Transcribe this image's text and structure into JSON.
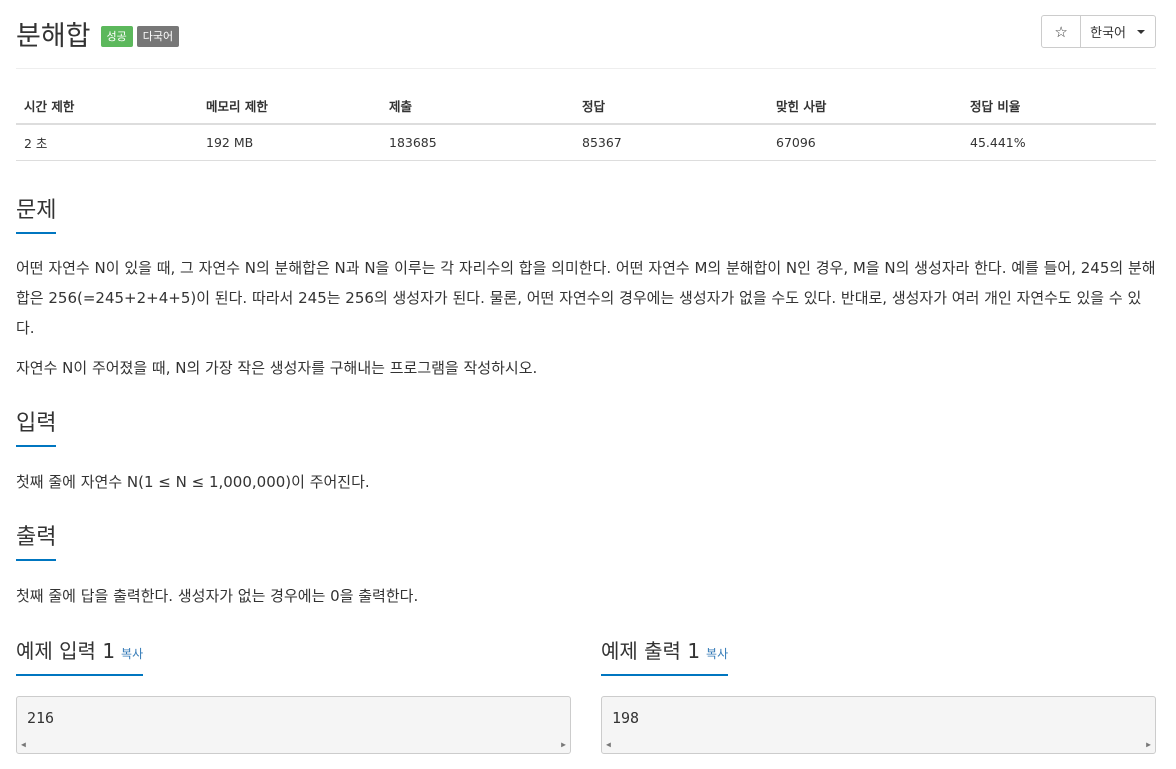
{
  "problem": {
    "title": "분해합",
    "badges": [
      "성공",
      "다국어"
    ],
    "language": "한국어",
    "star_icon": "☆"
  },
  "info_table": {
    "headers": [
      "시간 제한",
      "메모리 제한",
      "제출",
      "정답",
      "맞힌 사람",
      "정답 비율"
    ],
    "values": [
      "2 초",
      "192 MB",
      "183685",
      "85367",
      "67096",
      "45.441%"
    ]
  },
  "sections": {
    "description": {
      "heading": "문제",
      "paragraphs": [
        "어떤 자연수 N이 있을 때, 그 자연수 N의 분해합은 N과 N을 이루는 각 자리수의 합을 의미한다. 어떤 자연수 M의 분해합이 N인 경우, M을 N의 생성자라 한다. 예를 들어, 245의 분해합은 256(=245+2+4+5)이 된다. 따라서 245는 256의 생성자가 된다. 물론, 어떤 자연수의 경우에는 생성자가 없을 수도 있다. 반대로, 생성자가 여러 개인 자연수도 있을 수 있다.",
        "자연수 N이 주어졌을 때, N의 가장 작은 생성자를 구해내는 프로그램을 작성하시오."
      ]
    },
    "input": {
      "heading": "입력",
      "text": "첫째 줄에 자연수 N(1 ≤ N ≤ 1,000,000)이 주어진다."
    },
    "output": {
      "heading": "출력",
      "text": "첫째 줄에 답을 출력한다. 생성자가 없는 경우에는 0을 출력한다."
    }
  },
  "samples": {
    "input": {
      "heading": "예제 입력 1",
      "copy_label": "복사",
      "content": "216"
    },
    "output": {
      "heading": "예제 출력 1",
      "copy_label": "복사",
      "content": "198"
    }
  },
  "colors": {
    "success_badge": "#5cb85c",
    "lang_badge": "#777777",
    "accent_underline": "#0076c0",
    "link": "#337ab7"
  }
}
